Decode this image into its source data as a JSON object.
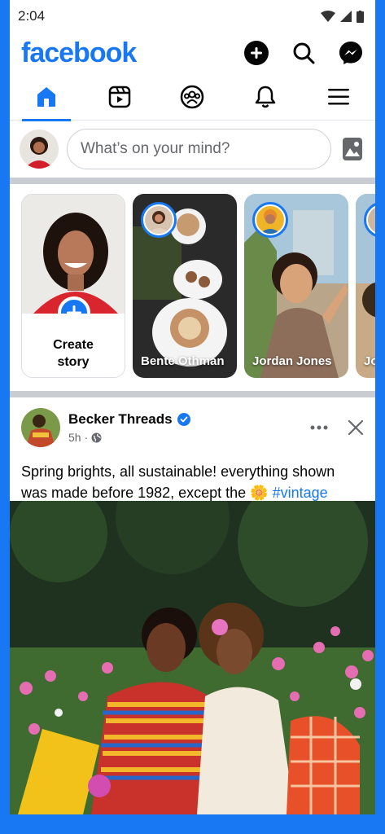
{
  "status_bar": {
    "time": "2:04"
  },
  "header": {
    "logo": "facebook",
    "actions": [
      "plus-icon",
      "search-icon",
      "messenger-icon"
    ]
  },
  "tabs": [
    {
      "name": "home",
      "active": true
    },
    {
      "name": "reels",
      "active": false
    },
    {
      "name": "groups",
      "active": false
    },
    {
      "name": "notifications",
      "active": false
    },
    {
      "name": "menu",
      "active": false
    }
  ],
  "composer": {
    "placeholder": "What’s on your mind?"
  },
  "stories": {
    "create_label": "Create\nstory",
    "items": [
      {
        "name": "Bente Othman"
      },
      {
        "name": "Jordan Jones"
      },
      {
        "name": "Jo Ly"
      }
    ]
  },
  "post": {
    "author": "Becker Threads",
    "verified": true,
    "time": "5h",
    "privacy": "globe-icon",
    "text_before": "Spring brights, all sustainable! everything shown was made before 1982, except the ",
    "emoji": "🌼",
    "hashtag": "#vintage"
  },
  "colors": {
    "brand": "#1877f2",
    "text": "#050505",
    "muted": "#65676b"
  }
}
